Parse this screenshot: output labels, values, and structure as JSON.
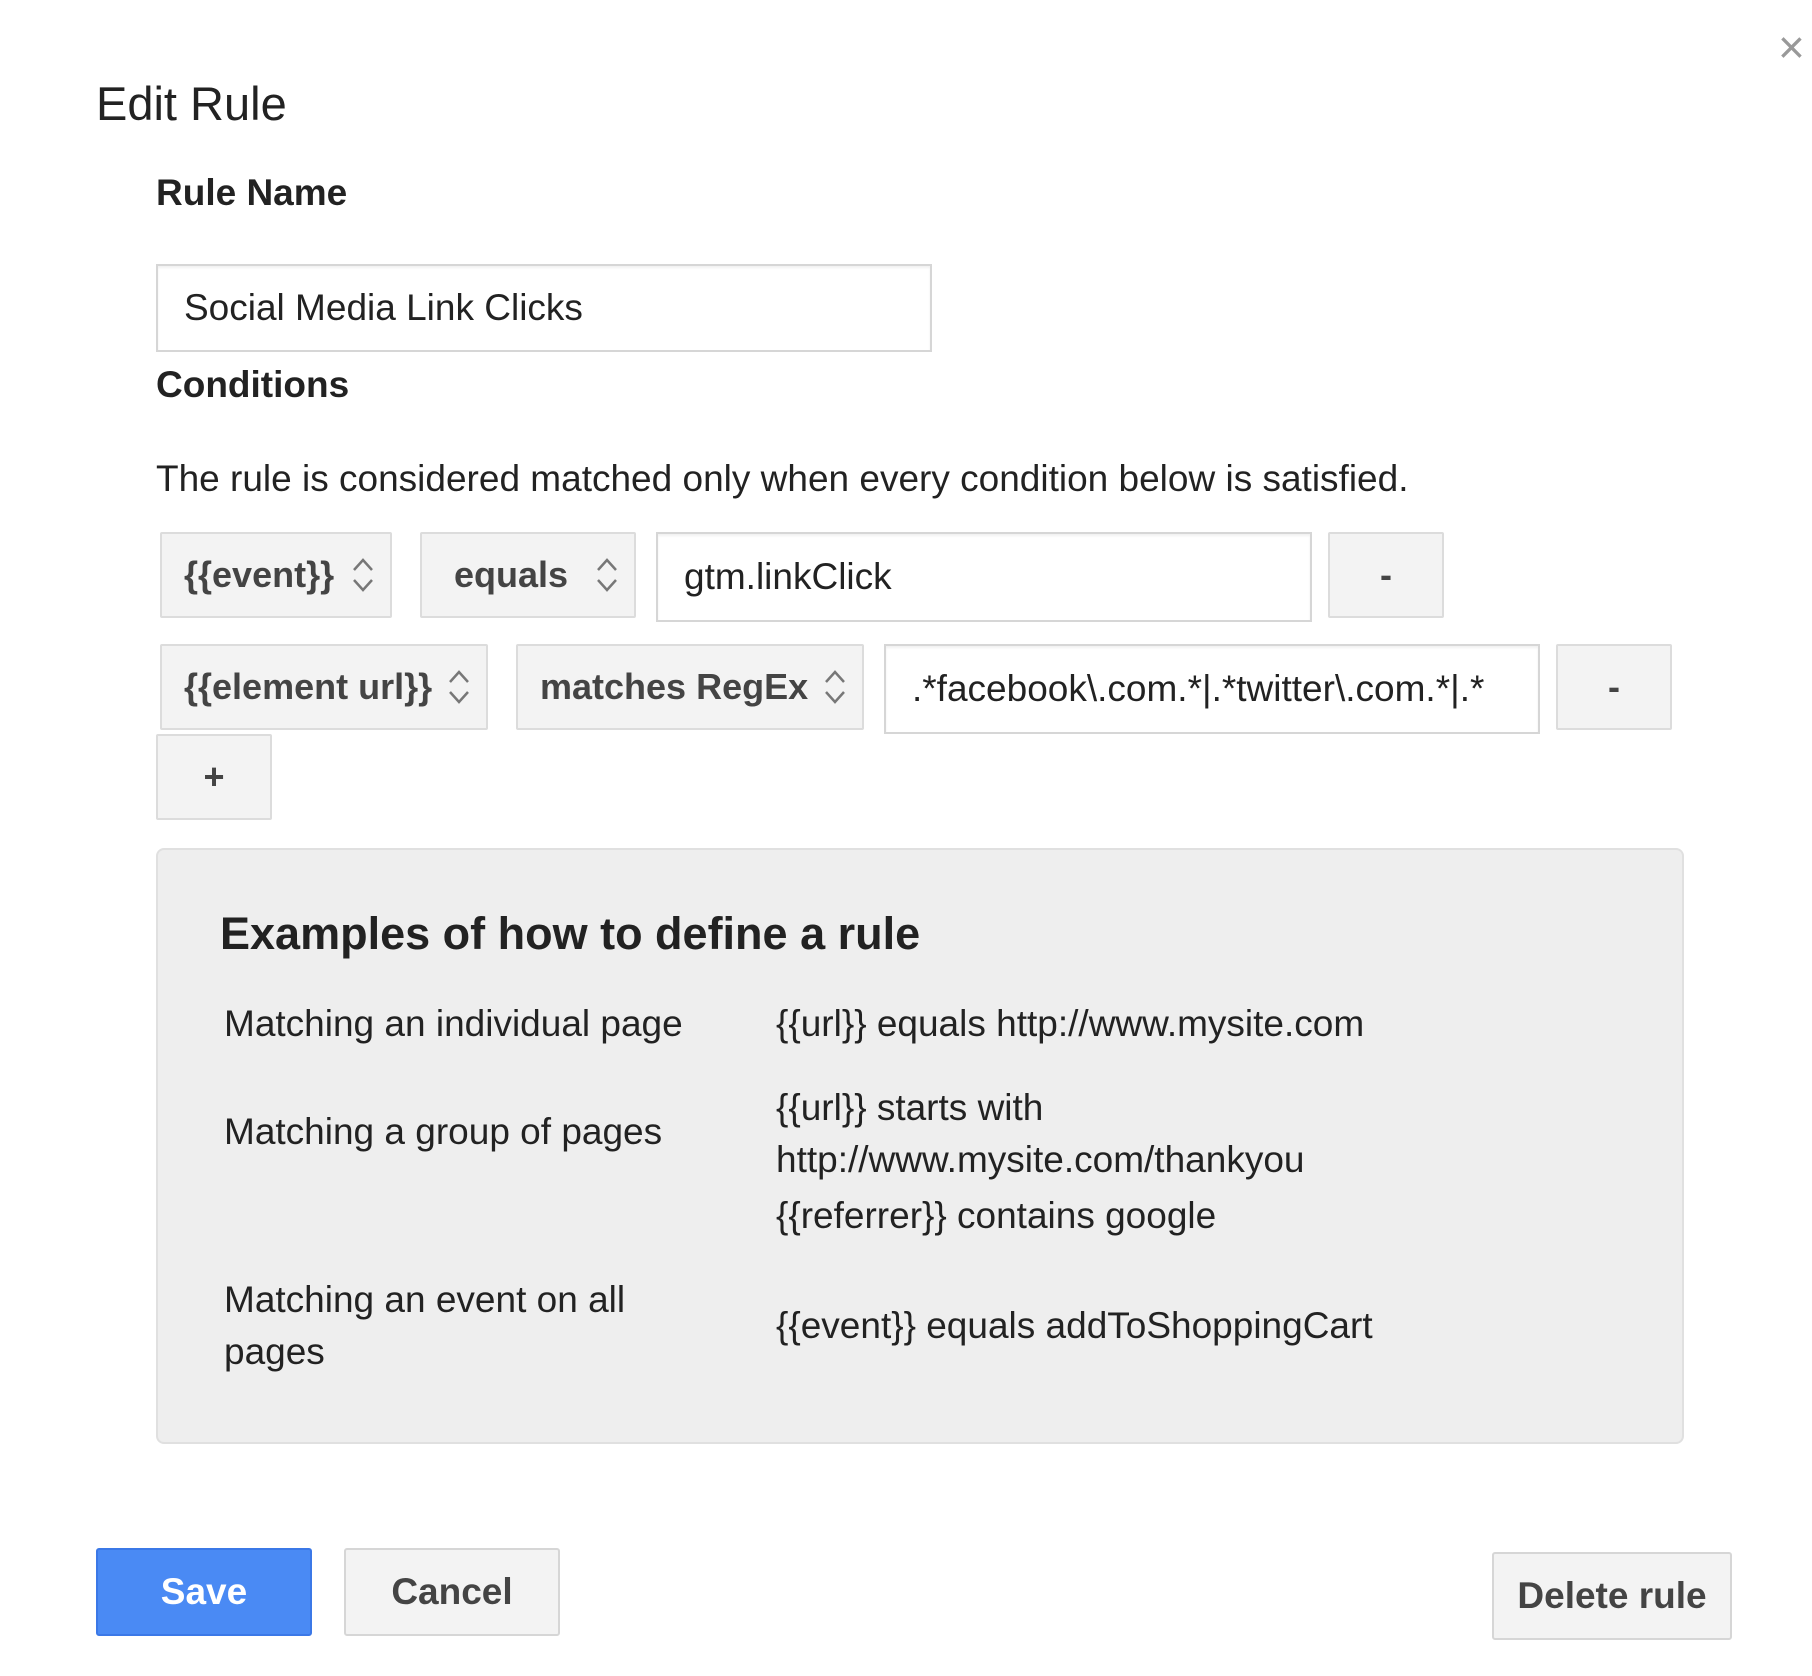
{
  "dialog": {
    "title": "Edit Rule",
    "close_glyph": "×"
  },
  "rule_name": {
    "label": "Rule Name",
    "value": "Social Media Link Clicks"
  },
  "conditions": {
    "label": "Conditions",
    "description": "The rule is considered matched only when every condition below is satisfied.",
    "rows": [
      {
        "variable": "{{event}}",
        "operator": "equals",
        "value": "gtm.linkClick",
        "remove_label": "-"
      },
      {
        "variable": "{{element url}}",
        "operator": "matches RegEx",
        "value": ".*facebook\\.com.*|.*twitter\\.com.*|.*",
        "remove_label": "-"
      }
    ],
    "add_label": "+"
  },
  "examples": {
    "title": "Examples of how to define a rule",
    "items": [
      {
        "label_lines": [
          "Matching an individual page"
        ],
        "value_lines": [
          "{{url}} equals http://www.mysite.com"
        ]
      },
      {
        "label_lines": [
          "Matching a group of pages"
        ],
        "value_lines": [
          "{{url}} starts with",
          "http://www.mysite.com/thankyou",
          "{{referrer}} contains google"
        ]
      },
      {
        "label_lines": [
          "Matching an event on all",
          "pages"
        ],
        "value_lines": [
          "{{event}} equals addToShoppingCart"
        ]
      }
    ]
  },
  "actions": {
    "save_label": "Save",
    "cancel_label": "Cancel",
    "delete_label": "Delete rule"
  },
  "colors": {
    "primary": "#4a8af4",
    "panel_bg": "#eeeeee",
    "button_bg": "#f3f3f3"
  }
}
